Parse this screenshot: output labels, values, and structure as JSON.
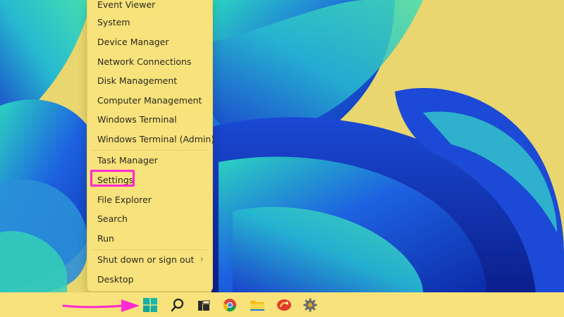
{
  "menu": {
    "items": [
      {
        "label": "Event Viewer"
      },
      {
        "label": "System"
      },
      {
        "label": "Device Manager"
      },
      {
        "label": "Network Connections"
      },
      {
        "label": "Disk Management"
      },
      {
        "label": "Computer Management"
      },
      {
        "label": "Windows Terminal"
      },
      {
        "label": "Windows Terminal (Admin)"
      },
      {
        "label": "Task Manager"
      },
      {
        "label": "Settings",
        "highlighted": true
      },
      {
        "label": "File Explorer"
      },
      {
        "label": "Search"
      },
      {
        "label": "Run"
      },
      {
        "label": "Shut down or sign out",
        "has_submenu": true
      },
      {
        "label": "Desktop"
      }
    ],
    "submenu_glyph": "›"
  },
  "taskbar": {
    "icons": [
      {
        "name": "windows-start-icon"
      },
      {
        "name": "search-icon"
      },
      {
        "name": "task-view-icon"
      },
      {
        "name": "chrome-icon"
      },
      {
        "name": "file-explorer-icon"
      },
      {
        "name": "store-app-icon"
      },
      {
        "name": "settings-gear-icon"
      }
    ]
  },
  "colors": {
    "menu_bg": "#f8e27c",
    "highlight": "#ff2ad1",
    "arrow": "#ff2ad1",
    "wallpaper_blue": "#1f4fd8",
    "wallpaper_teal": "#2ec9b8"
  }
}
